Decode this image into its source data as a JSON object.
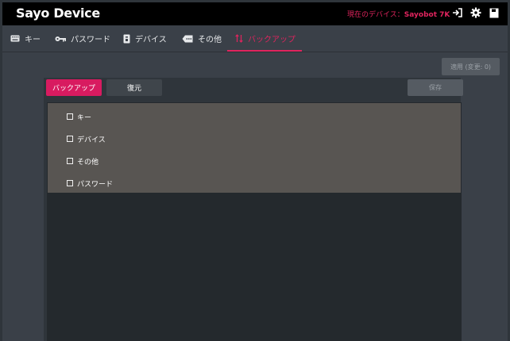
{
  "app": {
    "title": "Sayo Device",
    "device_prefix": "現在のデバイス：",
    "device_name": "Sayobot 7K"
  },
  "topbar": {
    "icons": [
      "login-icon",
      "gear-icon",
      "save-icon"
    ]
  },
  "nav": {
    "tabs": [
      {
        "label": "キー",
        "icon": "keyboard-icon"
      },
      {
        "label": "パスワード",
        "icon": "key-icon"
      },
      {
        "label": "デバイス",
        "icon": "device-icon"
      },
      {
        "label": "その他",
        "icon": "more-icon"
      },
      {
        "label": "バックアップ",
        "icon": "sort-icon",
        "active": true
      }
    ]
  },
  "toolbar": {
    "apply_label": "適用 (変更: 0)",
    "backup_label": "バックアップ",
    "restore_label": "復元",
    "save_label": "保存"
  },
  "backup": {
    "items": [
      {
        "label": "キー",
        "checked": false
      },
      {
        "label": "デバイス",
        "checked": false
      },
      {
        "label": "その他",
        "checked": false
      },
      {
        "label": "パスワード",
        "checked": false
      }
    ]
  },
  "colors": {
    "accent": "#e0245e",
    "topbar_bg": "#000000",
    "page_bg": "#3a4048"
  }
}
